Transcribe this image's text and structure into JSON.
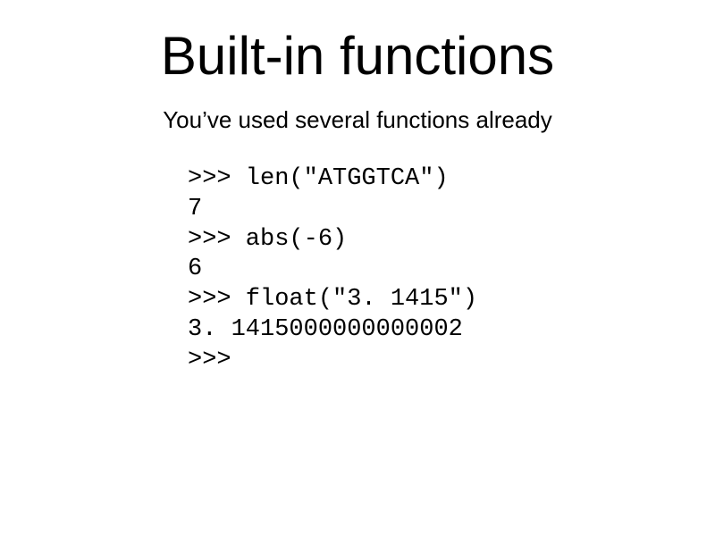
{
  "title": "Built-in functions",
  "subtitle": "You’ve used several functions already",
  "code": {
    "line1": ">>> len(\"ATGGTCA\")",
    "line2": "7",
    "line3": ">>> abs(-6)",
    "line4": "6",
    "line5": ">>> float(\"3. 1415\")",
    "line6": "3. 1415000000000002",
    "line7": ">>> "
  }
}
